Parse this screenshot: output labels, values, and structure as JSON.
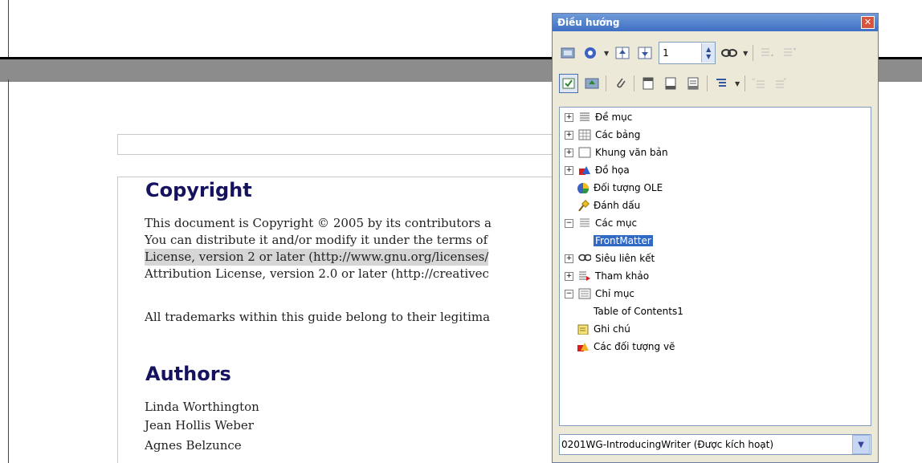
{
  "document": {
    "heading_copyright": "Copyright",
    "copyright_lines": [
      "This document is Copyright © 2005 by its contributors a",
      "You can distribute it and/or modify it under the terms of",
      "License, version 2 or later (http://www.gnu.org/licenses/",
      "Attribution License, version 2.0 or later (http://creativec"
    ],
    "trademarks_line": "All trademarks within this guide belong to their legitima",
    "heading_authors": "Authors",
    "authors": [
      "Linda Worthington",
      "Jean Hollis Weber",
      "Agnes Belzunce"
    ]
  },
  "navigator": {
    "title": "Điều hướng",
    "close_icon": "close-icon",
    "page_number": "1",
    "toolbar_row1": [
      "toggle-icon",
      "navigation-icon",
      "previous-icon",
      "next-icon",
      "page-spin",
      "hyperlink-icon",
      "promote-chapter-icon",
      "demote-chapter-icon"
    ],
    "toolbar_row2": [
      "content-view-icon",
      "drag-mode-icon",
      "reminder-icon",
      "header-icon",
      "footer-icon",
      "anchor-icon",
      "heading-levels-icon",
      "promote-level-icon",
      "demote-level-icon"
    ],
    "tree": [
      {
        "label": "Đề mục",
        "icon": "headings-icon",
        "expander": "+"
      },
      {
        "label": "Các bảng",
        "icon": "tables-icon",
        "expander": "+"
      },
      {
        "label": "Khung văn bản",
        "icon": "frames-icon",
        "expander": "+"
      },
      {
        "label": "Đồ họa",
        "icon": "graphics-icon",
        "expander": "+"
      },
      {
        "label": "Đối tượng OLE",
        "icon": "ole-objects-icon",
        "expander": ""
      },
      {
        "label": "Đánh dấu",
        "icon": "bookmarks-icon",
        "expander": ""
      },
      {
        "label": "Các mục",
        "icon": "sections-icon",
        "expander": "−"
      },
      {
        "label": "FrontMatter",
        "icon": "",
        "expander": "",
        "selected": true
      },
      {
        "label": "Siêu liên kết",
        "icon": "hyperlinks-icon",
        "expander": "+"
      },
      {
        "label": "Tham khảo",
        "icon": "references-icon",
        "expander": "+"
      },
      {
        "label": "Chỉ mục",
        "icon": "indexes-icon",
        "expander": "−"
      },
      {
        "label": "Table of Contents1",
        "icon": "",
        "expander": ""
      },
      {
        "label": "Ghi chú",
        "icon": "notes-icon",
        "expander": ""
      },
      {
        "label": "Các đối tượng vẽ",
        "icon": "drawing-objects-icon",
        "expander": ""
      }
    ],
    "document_select": "0201WG-IntroducingWriter (Được kích hoạt)"
  },
  "colors": {
    "heading": "#15125f",
    "titlebar": "#3f6fc4",
    "selection": "#316ac5"
  }
}
